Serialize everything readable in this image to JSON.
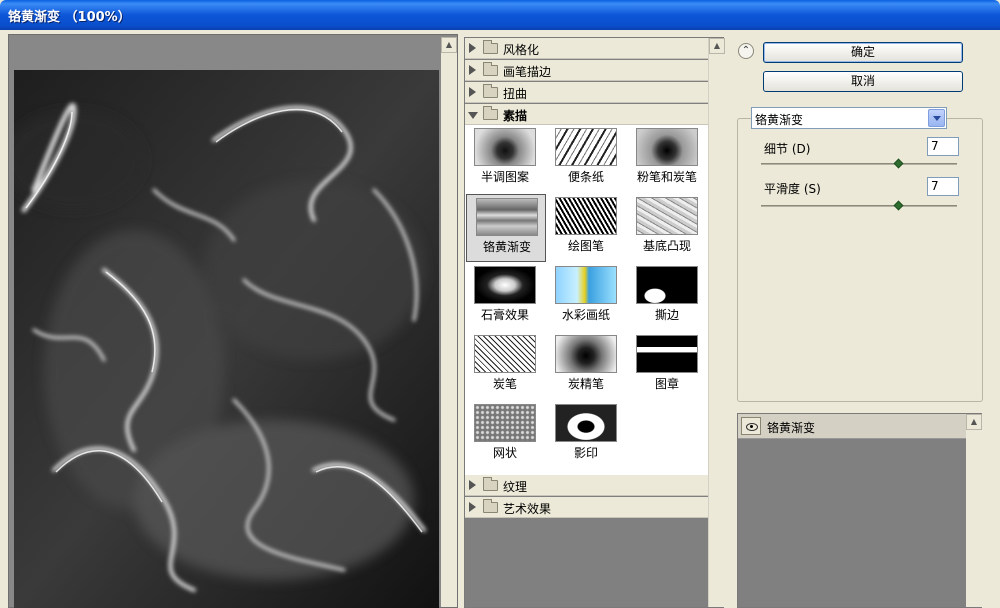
{
  "window": {
    "title": "铬黄渐变 （100%）"
  },
  "categories_top": [
    {
      "label": "风格化",
      "open": false
    },
    {
      "label": "画笔描边",
      "open": false
    },
    {
      "label": "扭曲",
      "open": false
    },
    {
      "label": "素描",
      "open": true
    }
  ],
  "thumbnails": [
    {
      "label": "半调图案",
      "selected": false
    },
    {
      "label": "便条纸",
      "selected": false
    },
    {
      "label": "粉笔和炭笔",
      "selected": false
    },
    {
      "label": "铬黄渐变",
      "selected": true
    },
    {
      "label": "绘图笔",
      "selected": false
    },
    {
      "label": "基底凸现",
      "selected": false
    },
    {
      "label": "石膏效果",
      "selected": false
    },
    {
      "label": "水彩画纸",
      "selected": false
    },
    {
      "label": "撕边",
      "selected": false
    },
    {
      "label": "炭笔",
      "selected": false
    },
    {
      "label": "炭精笔",
      "selected": false
    },
    {
      "label": "图章",
      "selected": false
    },
    {
      "label": "网状",
      "selected": false
    },
    {
      "label": "影印",
      "selected": false
    }
  ],
  "categories_bottom": [
    {
      "label": "纹理",
      "open": false
    },
    {
      "label": "艺术效果",
      "open": false
    }
  ],
  "buttons": {
    "ok": "确定",
    "cancel": "取消"
  },
  "filter_select": {
    "value": "铬黄渐变"
  },
  "params": {
    "detail": {
      "label": "细节 (D)",
      "value": "7",
      "slider_fraction": 0.7
    },
    "smoothness": {
      "label": "平滑度 (S)",
      "value": "7",
      "slider_fraction": 0.7
    }
  },
  "layer": {
    "label": "铬黄渐变"
  }
}
